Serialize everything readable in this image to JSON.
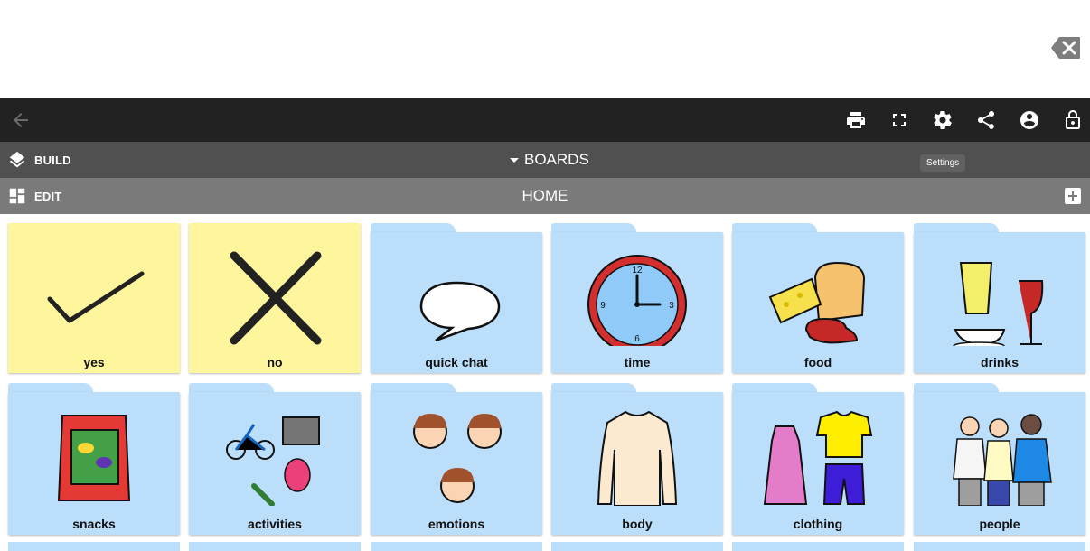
{
  "toolbar": {
    "icons": [
      "back-arrow-icon",
      "print-icon",
      "fullscreen-icon",
      "gear-icon",
      "share-icon",
      "account-icon",
      "lock-icon"
    ],
    "settings_tooltip": "Settings"
  },
  "build_bar": {
    "button_label": "BUILD",
    "boards_label": "BOARDS"
  },
  "edit_bar": {
    "button_label": "EDIT",
    "title": "HOME"
  },
  "colors": {
    "yes_no_tile": "#fff59d",
    "folder_tile": "#bbdefb",
    "top_bar": "#222222",
    "build_bar": "#505050",
    "edit_bar": "#7a7a7a"
  },
  "tiles": [
    {
      "label": "yes",
      "kind": "plain",
      "icon": "checkmark-icon"
    },
    {
      "label": "no",
      "kind": "plain",
      "icon": "cross-icon"
    },
    {
      "label": "quick chat",
      "kind": "folder",
      "icon": "speech-bubble-icon"
    },
    {
      "label": "time",
      "kind": "folder",
      "icon": "clock-icon"
    },
    {
      "label": "food",
      "kind": "folder",
      "icon": "food-icon"
    },
    {
      "label": "drinks",
      "kind": "folder",
      "icon": "drinks-icon"
    },
    {
      "label": "snacks",
      "kind": "folder",
      "icon": "snack-bag-icon"
    },
    {
      "label": "activities",
      "kind": "folder",
      "icon": "activities-icon"
    },
    {
      "label": "emotions",
      "kind": "folder",
      "icon": "faces-icon"
    },
    {
      "label": "body",
      "kind": "folder",
      "icon": "body-icon"
    },
    {
      "label": "clothing",
      "kind": "folder",
      "icon": "clothing-icon"
    },
    {
      "label": "people",
      "kind": "folder",
      "icon": "people-icon"
    }
  ]
}
